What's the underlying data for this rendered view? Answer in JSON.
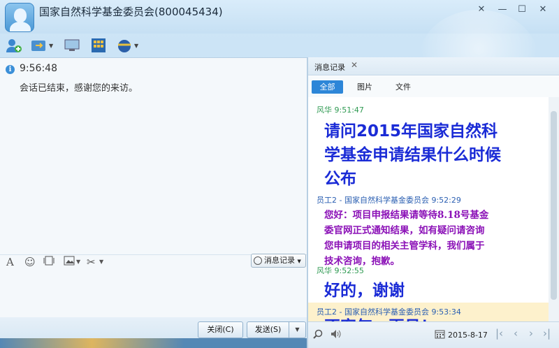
{
  "window": {
    "title": "国家自然科学基金委员会(800045434)",
    "controls": {
      "menu": "✕",
      "minimize": "—",
      "maximize": "☐",
      "close": "✕"
    }
  },
  "toolbar": {
    "icons": [
      "add-contact-icon",
      "transfer-file-icon",
      "remote-desktop-icon",
      "app-grid-icon",
      "shortcut-icon"
    ]
  },
  "chat": {
    "system_time": "9:56:48",
    "system_message": "会话已结束，感谢您的来访。"
  },
  "input_toolbar": {
    "font": "A",
    "emoji": "☺",
    "history_button": "消息记录"
  },
  "buttons": {
    "close": "关闭(C)",
    "send": "发送(S)"
  },
  "history_panel": {
    "tab_label": "消息记录",
    "filters": [
      "全部",
      "图片",
      "文件"
    ],
    "active_filter": "全部",
    "messages": [
      {
        "sender": "风华",
        "time": "9:51:47",
        "text_lines": [
          "请问2015年国家自然科",
          "学基金申请结果什么时候",
          "公布"
        ]
      },
      {
        "sender": "员工2 - 国家自然科学基金委员会",
        "time": "9:52:29",
        "text_lines": [
          "您好：项目申报结果请等待8.18号基金",
          "委官网正式通知结果，如有疑问请咨询",
          "您申请项目的相关主管学科，我们属于",
          "技术咨询，抱歉。"
        ]
      },
      {
        "sender": "风华",
        "time": "9:52:55",
        "text_lines": [
          "好的，谢谢"
        ]
      },
      {
        "sender": "员工2 - 国家自然科学基金委员会",
        "time": "9:53:34",
        "text_lines": [
          "不客气，再见！"
        ]
      }
    ],
    "date": "2015-8-17"
  },
  "colors": {
    "accent": "#2d86d8",
    "user_name": "#2f9a52",
    "staff_name": "#2b5fb2",
    "big_text": "#1a2bd6",
    "reply_text": "#8b11b7"
  }
}
